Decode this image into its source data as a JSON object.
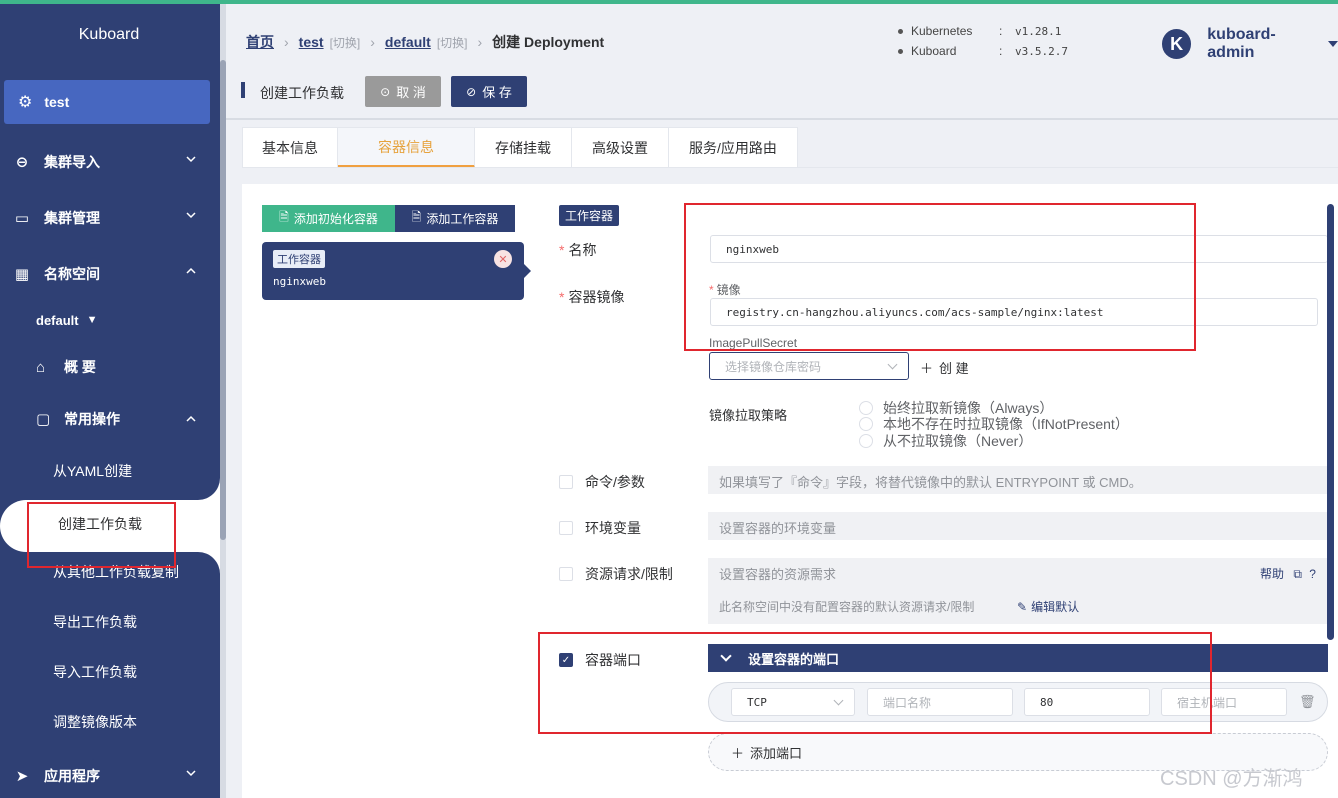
{
  "app": {
    "logo": "Kuboard",
    "cluster": "test"
  },
  "sidebar": {
    "items": [
      {
        "label": "集群导入",
        "icon": "link-icon"
      },
      {
        "label": "集群管理",
        "icon": "briefcase-icon"
      },
      {
        "label": "名称空间",
        "icon": "grid-icon"
      }
    ],
    "namespace": "default",
    "sub": [
      {
        "label": "概 要",
        "icon": "home-icon"
      },
      {
        "label": "常用操作",
        "icon": "folder-icon"
      }
    ],
    "leaves": [
      "从YAML创建",
      "创建工作负载",
      "从其他工作负载复制",
      "导出工作负载",
      "导入工作负载",
      "调整镜像版本"
    ],
    "bottom": {
      "label": "应用程序",
      "icon": "send-icon"
    }
  },
  "header": {
    "crumbs": {
      "home": "首页",
      "cluster": "test",
      "switch1": "[切换]",
      "ns": "default",
      "switch2": "[切换]",
      "page": "创建 Deployment"
    },
    "versions": [
      {
        "key": "Kubernetes",
        "colon": ":",
        "value": "v1.28.1"
      },
      {
        "key": "Kuboard",
        "colon": ":",
        "value": "v3.5.2.7"
      }
    ],
    "user": {
      "avatar": "K",
      "name": "kuboard-admin"
    }
  },
  "actionbar": {
    "title": "创建工作负载",
    "cancel": "取 消",
    "save": "保 存"
  },
  "tabs": [
    "基本信息",
    "容器信息",
    "存储挂载",
    "高级设置",
    "服务/应用路由"
  ],
  "containers": {
    "add_init": "添加初始化容器",
    "add_work": "添加工作容器",
    "card_tag": "工作容器",
    "card_name": "nginxweb"
  },
  "form": {
    "section_tag": "工作容器",
    "name_label": "名称",
    "name_value": "nginxweb",
    "image_label": "容器镜像",
    "image_sub": "镜像",
    "image_value": "registry.cn-hangzhou.aliyuncs.com/acs-sample/nginx:latest",
    "pull_secret_label": "ImagePullSecret",
    "pull_secret_placeholder": "选择镜像仓库密码",
    "create": "创 建",
    "pull_policy_label": "镜像拉取策略",
    "pull_policies": [
      "始终拉取新镜像（Always）",
      "本地不存在时拉取镜像（IfNotPresent）",
      "从不拉取镜像（Never）"
    ],
    "cmd_label": "命令/参数",
    "cmd_hint": "如果填写了『命令』字段，将替代镜像中的默认 ENTRYPOINT 或 CMD。",
    "env_label": "环境变量",
    "env_hint": "设置容器的环境变量",
    "res_label": "资源请求/限制",
    "res_hint": "设置容器的资源需求",
    "help": "帮助",
    "res_note": "此名称空间中没有配置容器的默认资源请求/限制",
    "edit_default": "编辑默认",
    "ports_label": "容器端口",
    "ports_title": "设置容器的端口",
    "port_protocol": "TCP",
    "port_name_placeholder": "端口名称",
    "port_value": "80",
    "host_port_placeholder": "宿主机端口",
    "add_port": "添加端口"
  },
  "watermark": "CSDN @方渐鸿"
}
